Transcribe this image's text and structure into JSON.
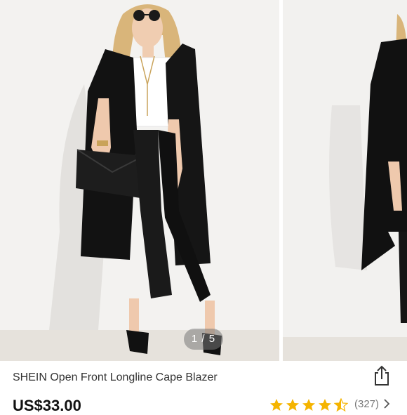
{
  "gallery": {
    "pager_text": "1 / 5"
  },
  "product": {
    "title": "SHEIN Open Front Longline Cape Blazer",
    "price": "US$33.00",
    "rating_stars": 4.5,
    "review_count": "(327)"
  },
  "colors": {
    "star": "#f5b400",
    "price": "#111111"
  },
  "icons": {
    "share": "share-icon",
    "chevron": "chevron-right-icon",
    "star": "star-icon"
  }
}
